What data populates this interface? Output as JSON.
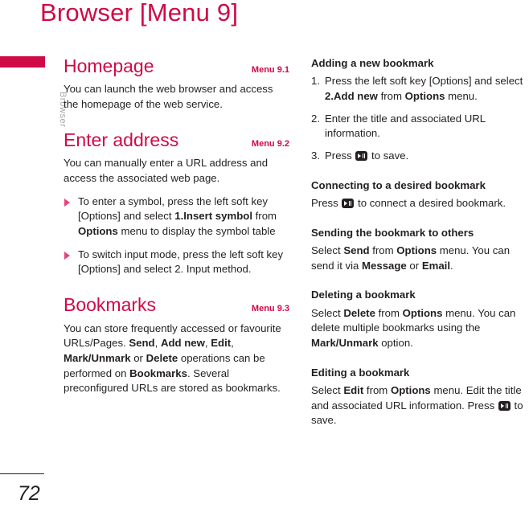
{
  "page": {
    "title": "Browser [Menu 9]",
    "number": "72",
    "accent_color": "#cf0a47",
    "bullet_color": "#e8447f",
    "text_color": "#231f20",
    "tab_label_color": "#a6a8ab"
  },
  "side_tab": {
    "label": "Browser"
  },
  "left_column": {
    "sections": [
      {
        "title": "Homepage",
        "menu": "Menu 9.1",
        "paragraph": "You can launch the web browser and access the homepage of the web service."
      },
      {
        "title": "Enter address",
        "menu": "Menu 9.2",
        "paragraph": "You can manually enter a URL address and access the associated web page.",
        "bullets": [
          {
            "parts": [
              {
                "t": "To enter a symbol, press the left soft key [Options] and select ",
                "b": false
              },
              {
                "t": "1.Insert symbol",
                "b": true
              },
              {
                "t": " from ",
                "b": false
              },
              {
                "t": "Options",
                "b": true
              },
              {
                "t": " menu to display the symbol table",
                "b": false
              }
            ]
          },
          {
            "parts": [
              {
                "t": "To switch input mode, press the left soft key [Options] and select 2. Input method.",
                "b": false
              }
            ]
          }
        ]
      },
      {
        "title": "Bookmarks",
        "menu": "Menu 9.3",
        "rich_paragraph": [
          {
            "t": "You can store frequently accessed or favourite URLs/Pages. ",
            "b": false
          },
          {
            "t": "Send",
            "b": true
          },
          {
            "t": ", ",
            "b": false
          },
          {
            "t": "Add new",
            "b": true
          },
          {
            "t": ", ",
            "b": false
          },
          {
            "t": "Edit",
            "b": true
          },
          {
            "t": ", ",
            "b": false
          },
          {
            "t": "Mark/Unmark",
            "b": true
          },
          {
            "t": " or ",
            "b": false
          },
          {
            "t": "Delete",
            "b": true
          },
          {
            "t": " operations can be performed on ",
            "b": false
          },
          {
            "t": "Bookmarks",
            "b": true
          },
          {
            "t": ". Several preconfigured URLs are stored as bookmarks.",
            "b": false
          }
        ]
      }
    ]
  },
  "right_column": {
    "sections": [
      {
        "heading": "Adding a new bookmark",
        "steps": [
          {
            "num": "1.",
            "parts": [
              {
                "t": "Press the left soft key [Options] and select ",
                "b": false
              },
              {
                "t": "2.Add new",
                "b": true
              },
              {
                "t": " from ",
                "b": false
              },
              {
                "t": "Options",
                "b": true
              },
              {
                "t": " menu.",
                "b": false
              }
            ]
          },
          {
            "num": "2.",
            "parts": [
              {
                "t": "Enter the title and associated URL information.",
                "b": false
              }
            ]
          },
          {
            "num": "3.",
            "parts": [
              {
                "t": "Press ",
                "b": false
              },
              {
                "icon": "ok-key-icon"
              },
              {
                "t": " to save.",
                "b": false
              }
            ]
          }
        ]
      },
      {
        "heading": "Connecting to a desired bookmark",
        "parts": [
          {
            "t": "Press ",
            "b": false
          },
          {
            "icon": "ok-key-icon"
          },
          {
            "t": " to connect a desired bookmark.",
            "b": false
          }
        ]
      },
      {
        "heading": "Sending the bookmark to others",
        "parts": [
          {
            "t": "Select ",
            "b": false
          },
          {
            "t": "Send",
            "b": true
          },
          {
            "t": " from ",
            "b": false
          },
          {
            "t": "Options",
            "b": true
          },
          {
            "t": " menu. You can send it via ",
            "b": false
          },
          {
            "t": "Message",
            "b": true
          },
          {
            "t": " or ",
            "b": false
          },
          {
            "t": "Email",
            "b": true
          },
          {
            "t": ".",
            "b": false
          }
        ]
      },
      {
        "heading": "Deleting a bookmark",
        "parts": [
          {
            "t": "Select ",
            "b": false
          },
          {
            "t": "Delete",
            "b": true
          },
          {
            "t": " from ",
            "b": false
          },
          {
            "t": "Options",
            "b": true
          },
          {
            "t": " menu. You can delete multiple bookmarks using the ",
            "b": false
          },
          {
            "t": "Mark/Unmark",
            "b": true
          },
          {
            "t": " option.",
            "b": false
          }
        ]
      },
      {
        "heading": "Editing a bookmark",
        "parts": [
          {
            "t": "Select ",
            "b": false
          },
          {
            "t": "Edit",
            "b": true
          },
          {
            "t": " from ",
            "b": false
          },
          {
            "t": "Options",
            "b": true
          },
          {
            "t": " menu. Edit the title and associated URL information. Press ",
            "b": false
          },
          {
            "icon": "ok-key-icon"
          },
          {
            "t": " to save.",
            "b": false
          }
        ]
      }
    ]
  }
}
